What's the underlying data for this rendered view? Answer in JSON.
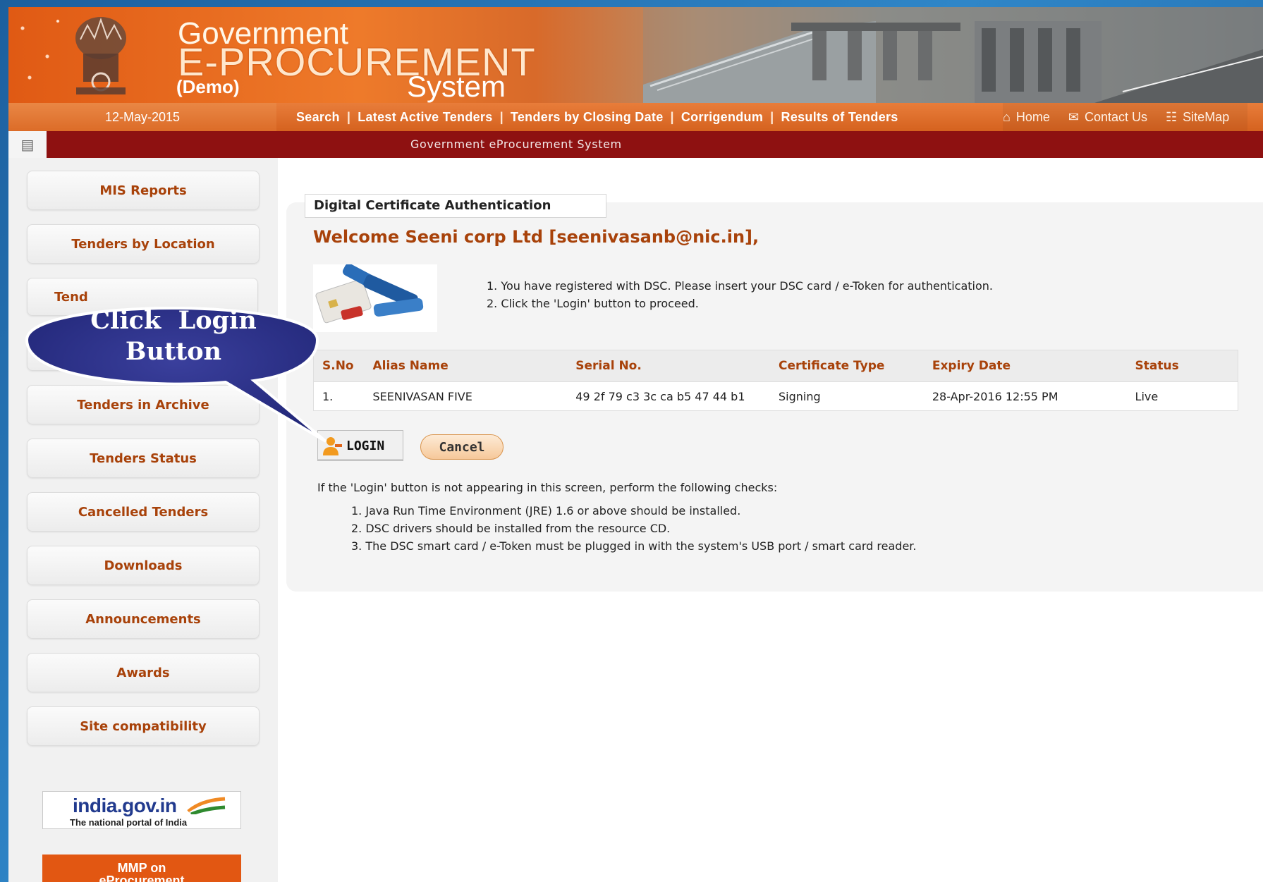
{
  "header": {
    "brand_line1": "Government",
    "brand_line2": "E-PROCUREMENT",
    "brand_demo": "(Demo)",
    "brand_line3": "System"
  },
  "navbar": {
    "date": "12-May-2015",
    "links": [
      "Search",
      "Latest Active Tenders",
      "Tenders by Closing Date",
      "Corrigendum",
      "Results of Tenders"
    ],
    "separator": "|",
    "right": [
      {
        "label": "Home",
        "icon": "home-icon"
      },
      {
        "label": "Contact Us",
        "icon": "mail-icon"
      },
      {
        "label": "SiteMap",
        "icon": "sitemap-icon"
      }
    ]
  },
  "strip": {
    "title": "Government eProcurement System"
  },
  "sidebar": {
    "items": [
      {
        "label": "MIS Reports"
      },
      {
        "label": "Tenders by Location"
      },
      {
        "label": "Tend"
      },
      {
        "label": ""
      },
      {
        "label": "Tenders in Archive"
      },
      {
        "label": "Tenders Status"
      },
      {
        "label": "Cancelled Tenders"
      },
      {
        "label": "Downloads"
      },
      {
        "label": "Announcements"
      },
      {
        "label": "Awards"
      },
      {
        "label": "Site compatibility"
      }
    ],
    "india_logo_main": "india.gov.in",
    "india_logo_sub": "The national portal of India",
    "mmp_line1": "MMP on",
    "mmp_line2": "eProcurement"
  },
  "main": {
    "tab_title": "Digital Certificate Authentication",
    "welcome": "Welcome Seeni corp Ltd [seenivasanb@nic.in],",
    "instructions": [
      "1. You have registered with DSC. Please insert your DSC card / e-Token for authentication.",
      "2. Click the 'Login' button to proceed."
    ],
    "table": {
      "headers": [
        "S.No",
        "Alias Name",
        "Serial No.",
        "Certificate Type",
        "Expiry Date",
        "Status"
      ],
      "rows": [
        [
          "1.",
          "SEENIVASAN FIVE",
          "49 2f 79 c3 3c ca b5 47 44 b1",
          "Signing",
          "28-Apr-2016 12:55 PM",
          "Live"
        ]
      ]
    },
    "login_label": "LOGIN",
    "cancel_label": "Cancel",
    "checks_intro": "If the 'Login' button is not appearing in this screen, perform the following checks:",
    "checks": [
      "1. Java Run Time Environment (JRE) 1.6 or above should be installed.",
      "2. DSC drivers should be installed from the resource CD.",
      "3. The DSC smart card / e-Token must be plugged in with the system's USB port / smart card reader."
    ]
  },
  "callout": {
    "line1": "Click  Login",
    "line2": "Button"
  },
  "colors": {
    "accent": "#a8420a",
    "nav_orange": "#d5621f",
    "strip_red": "#8e1111",
    "callout_blue": "#2a2f86"
  }
}
